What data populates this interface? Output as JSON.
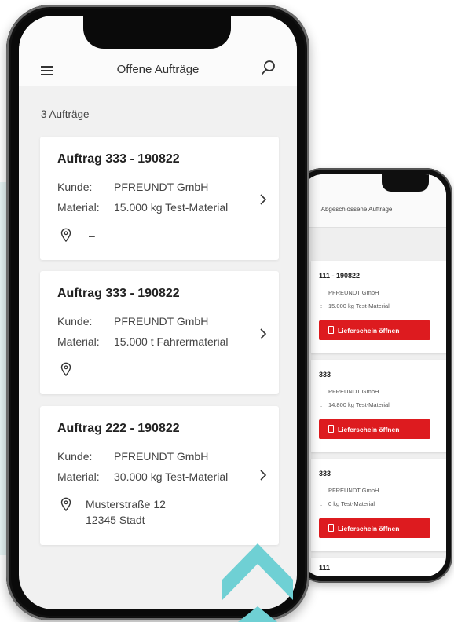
{
  "front": {
    "header": {
      "title": "Offene Aufträge"
    },
    "count_label": "3 Aufträge",
    "labels": {
      "customer": "Kunde:",
      "material": "Material:"
    },
    "orders": [
      {
        "title": "Auftrag 333 - 190822",
        "customer": "PFREUNDT GmbH",
        "material": "15.000 kg Test-Material",
        "location": "–"
      },
      {
        "title": "Auftrag 333 - 190822",
        "customer": "PFREUNDT GmbH",
        "material": "15.000 t Fahrermaterial",
        "location": "–"
      },
      {
        "title": "Auftrag 222 - 190822",
        "customer": "PFREUNDT GmbH",
        "material": "30.000 kg Test-Material",
        "location_line1": "Musterstraße 12",
        "location_line2": "12345 Stadt"
      }
    ]
  },
  "back": {
    "header": {
      "title": "Abgeschlossene Aufträge"
    },
    "orders": [
      {
        "title": "111 - 190822",
        "customer": "PFREUNDT GmbH",
        "material": "15.000 kg Test-Material",
        "button": "Lieferschein öffnen"
      },
      {
        "title": "333",
        "customer": "PFREUNDT GmbH",
        "material": "14.800 kg Test-Material",
        "button": "Lieferschein öffnen"
      },
      {
        "title": "333",
        "customer": "PFREUNDT GmbH",
        "material": "0 kg Test-Material",
        "button": "Lieferschein öffnen"
      },
      {
        "title": "111"
      }
    ]
  },
  "colors": {
    "accent_red": "#dd1b1f",
    "teal": "#6fd0d4",
    "screen_bg": "#f1f1f1"
  }
}
